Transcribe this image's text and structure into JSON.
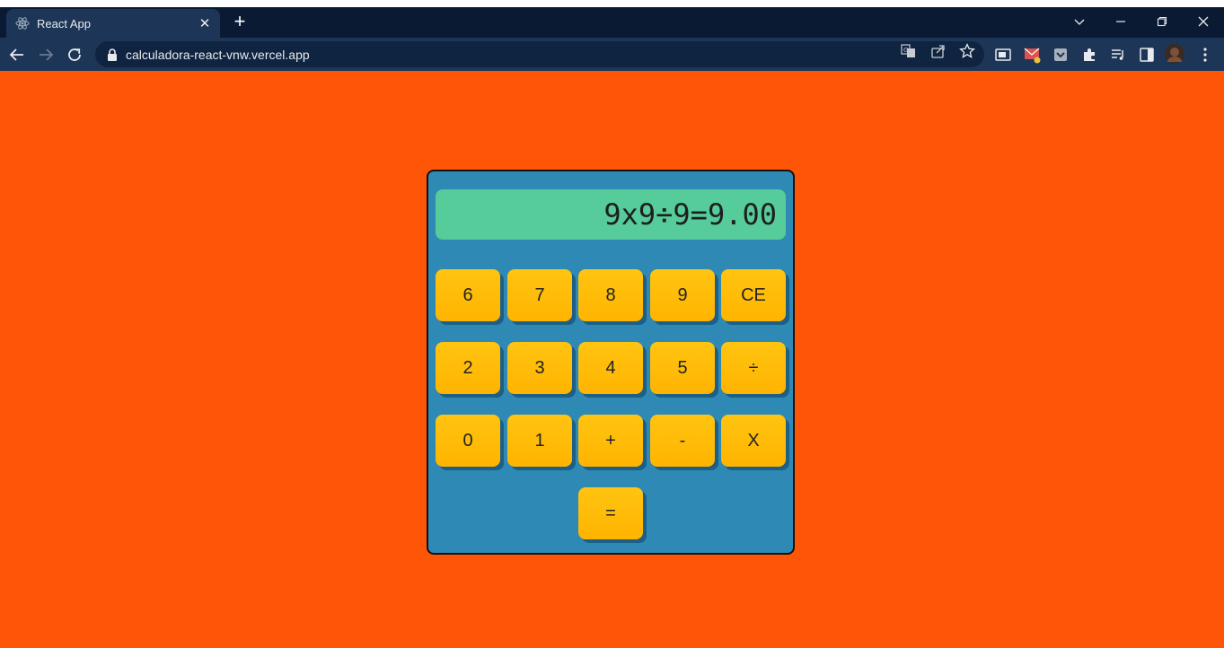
{
  "browser": {
    "tab_title": "React App",
    "url": "calculadora-react-vnw.vercel.app",
    "tab_close_glyph": "✕",
    "new_tab_glyph": "+"
  },
  "calculator": {
    "display": "9x9÷9=9.00",
    "rows": [
      [
        "6",
        "7",
        "8",
        "9",
        "CE"
      ],
      [
        "2",
        "3",
        "4",
        "5",
        "÷"
      ],
      [
        "0",
        "1",
        "+",
        "-",
        "X"
      ],
      [
        "="
      ]
    ]
  },
  "colors": {
    "page_background": "#ff5507",
    "calculator_body": "#2e8ab5",
    "display_background": "#55cc99",
    "key_background": "#ffbe0b"
  }
}
